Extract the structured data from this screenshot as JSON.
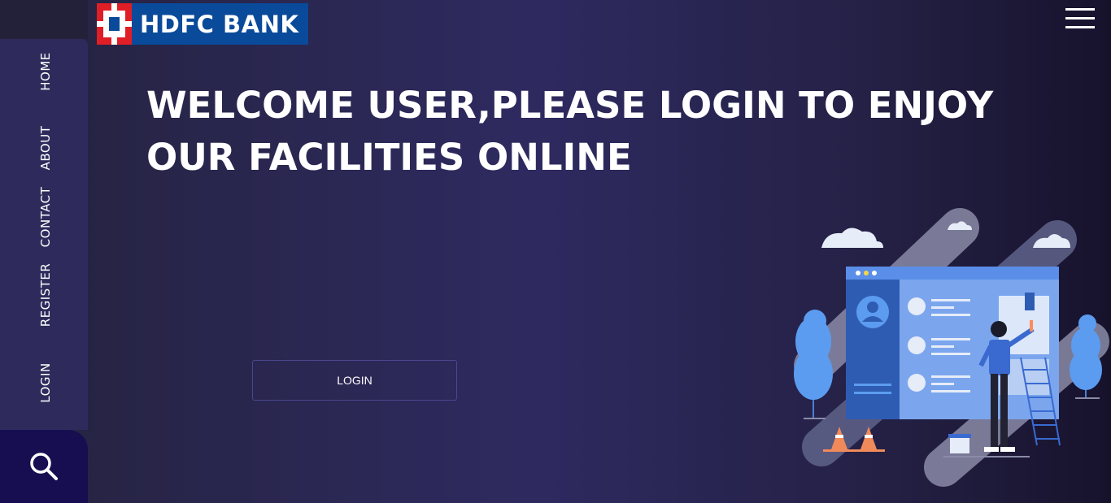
{
  "brand": {
    "name": "HDFC BANK",
    "colors": {
      "red": "#e01e25",
      "blue": "#0a4a9a"
    }
  },
  "sidebar": {
    "items": [
      {
        "label": "HOME"
      },
      {
        "label": "ABOUT"
      },
      {
        "label": "CONTACT"
      },
      {
        "label": "REGISTER"
      },
      {
        "label": "LOGIN"
      }
    ],
    "search_icon": "search-icon"
  },
  "header": {
    "menu_icon": "hamburger-menu-icon"
  },
  "main": {
    "headline": "WELCOME USER,PLEASE LOGIN TO ENJOY OUR FACILITIES ONLINE",
    "login_button": "LOGIN"
  },
  "theme": {
    "background": "#2e2a60",
    "sidebar": "#2e2b5c",
    "search_bg": "#170e52",
    "accent": "#5b8def"
  }
}
